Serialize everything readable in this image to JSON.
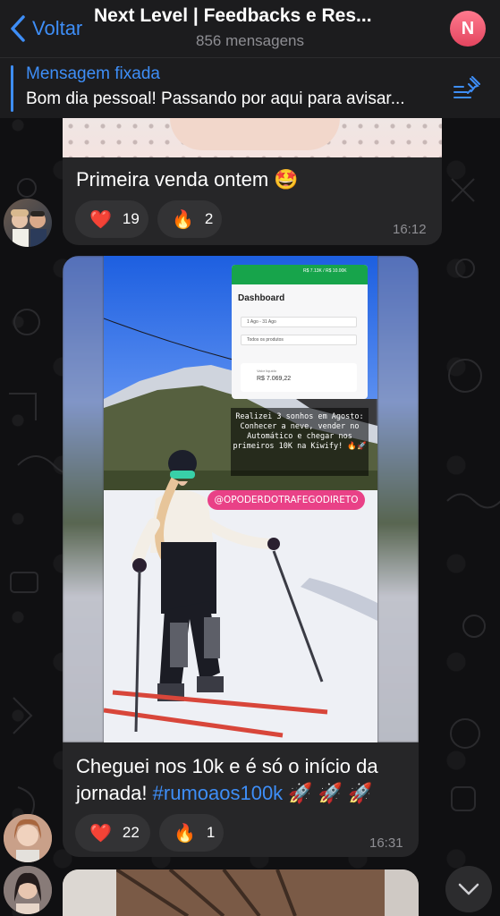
{
  "header": {
    "back_label": "Voltar",
    "title": "Next Level | Feedbacks e Res...",
    "subtitle": "856 mensagens",
    "avatar_letter": "N",
    "accent": "#3e8ef7"
  },
  "pinned": {
    "title": "Mensagem fixada",
    "text": "Bom dia pessoal! Passando por aqui para avisar..."
  },
  "messages": [
    {
      "text": "Primeira venda ontem 🤩",
      "reactions": [
        {
          "emoji": "❤️",
          "count": "19"
        },
        {
          "emoji": "🔥",
          "count": "2"
        }
      ],
      "time": "16:12"
    },
    {
      "photo": {
        "dashboard_title": "Dashboard",
        "dashboard_period": "1 Ago - 31 Ago",
        "dashboard_filter": "Todos os produtos",
        "dashboard_value_label": "Valor líquido",
        "dashboard_value": "R$ 7.069,22",
        "dashboard_progress": "R$ 7.13K / R$ 10.00K",
        "story_text": "Realizei 3 sonhos em Agosto: Conhecer a neve, vender no Automático e chegar nos primeiros 10K na Kiwify! 🔥🚀",
        "story_tag": "@OPODERDOTRAFEGODIRETO"
      },
      "text": "Cheguei nos 10k e é só o início da jornada!",
      "hashtag": "#rumoaos100k",
      "emojis": "🚀 🚀 🚀",
      "reactions": [
        {
          "emoji": "❤️",
          "count": "22"
        },
        {
          "emoji": "🔥",
          "count": "1"
        }
      ],
      "time": "16:31"
    }
  ]
}
